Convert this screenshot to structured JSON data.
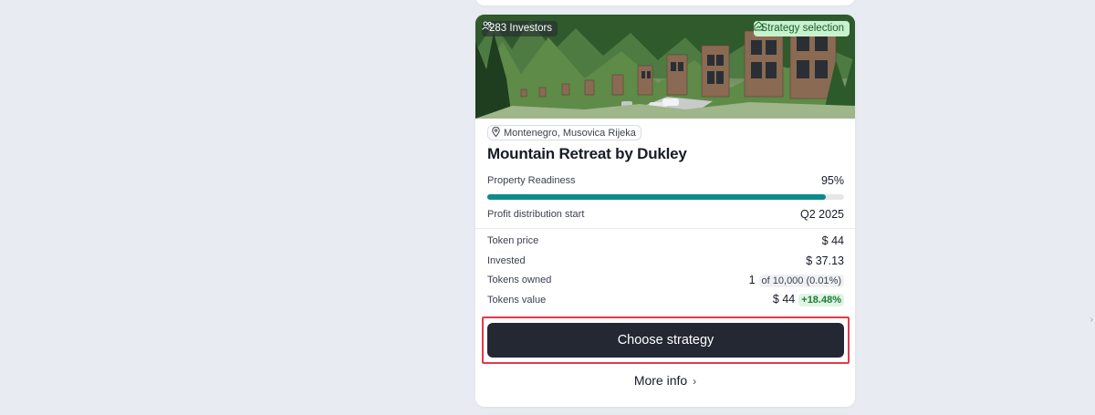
{
  "card": {
    "investors_badge": "283 Investors",
    "strategy_badge": "Strategy selection",
    "location": "Montenegro, Musovica Rijeka",
    "title": "Mountain Retreat by Dukley",
    "readiness_label": "Property Readiness",
    "readiness_value": "95%",
    "readiness_fraction": 0.95,
    "profit_label": "Profit distribution start",
    "profit_value": "Q2 2025",
    "token_price_label": "Token price",
    "token_price_value": "$ 44",
    "invested_label": "Invested",
    "invested_value": "$ 37.13",
    "tokens_owned_label": "Tokens owned",
    "tokens_owned_value": "1",
    "tokens_owned_sub": "of 10,000 (0.01%)",
    "tokens_value_label": "Tokens value",
    "tokens_value_value": "$ 44",
    "tokens_value_gain": "+18.48%",
    "choose_button": "Choose strategy",
    "more_info": "More info",
    "icons": {
      "investors": "people-icon",
      "strategy": "house-chart-icon",
      "location": "map-pin-icon",
      "more": "chevron-right-icon"
    },
    "colors": {
      "progress": "#0f8a8c",
      "button": "#232833",
      "highlight": "#e23a48",
      "gain": "#1c7a38"
    }
  }
}
